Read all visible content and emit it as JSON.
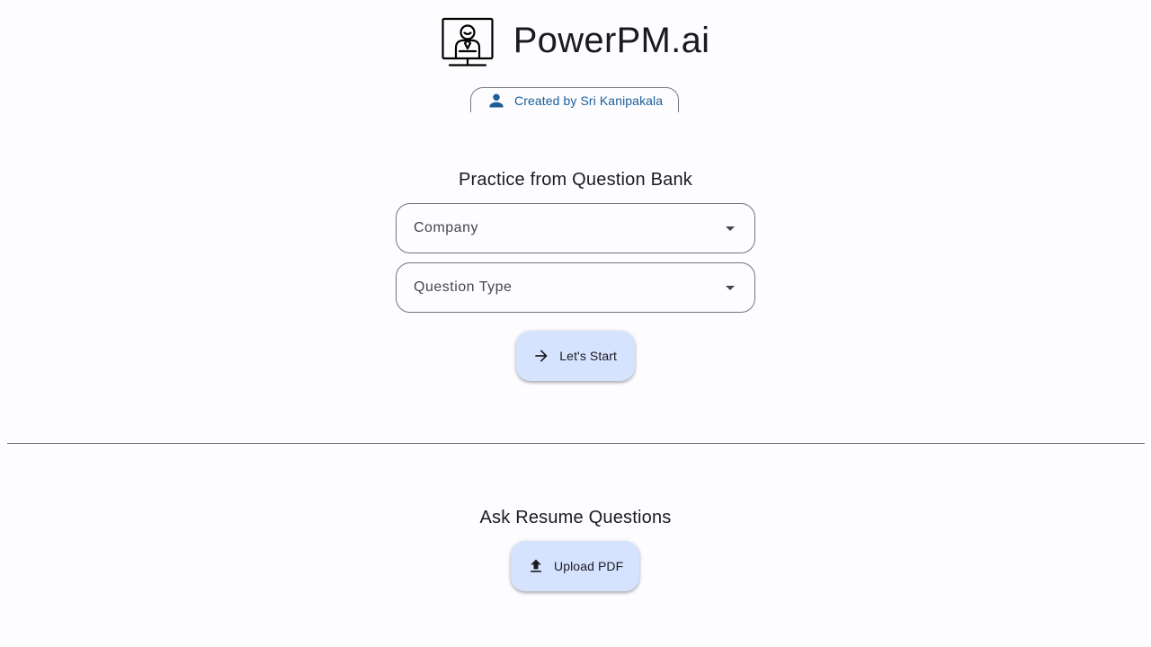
{
  "app": {
    "title": "PowerPM.ai",
    "logo_icon": "presenter-at-screen-icon"
  },
  "creator_chip": {
    "icon": "person-icon",
    "label": "Created by Sri Kanipakala",
    "label_color": "#1a5f9a"
  },
  "question_bank": {
    "title": "Practice from Question Bank",
    "company_select": {
      "label": "Company",
      "icon": "dropdown-arrow-icon"
    },
    "question_type_select": {
      "label": "Question Type",
      "icon": "dropdown-arrow-icon"
    },
    "start_button": {
      "label": "Let's Start",
      "icon": "arrow-right-icon"
    }
  },
  "resume": {
    "title": "Ask Resume Questions",
    "upload_button": {
      "label": "Upload PDF",
      "icon": "upload-icon"
    }
  },
  "colors": {
    "background": "#fdfcff",
    "button_container": "#d6e3ff",
    "outline": "#74777f",
    "on_surface": "#1b1b1f"
  }
}
